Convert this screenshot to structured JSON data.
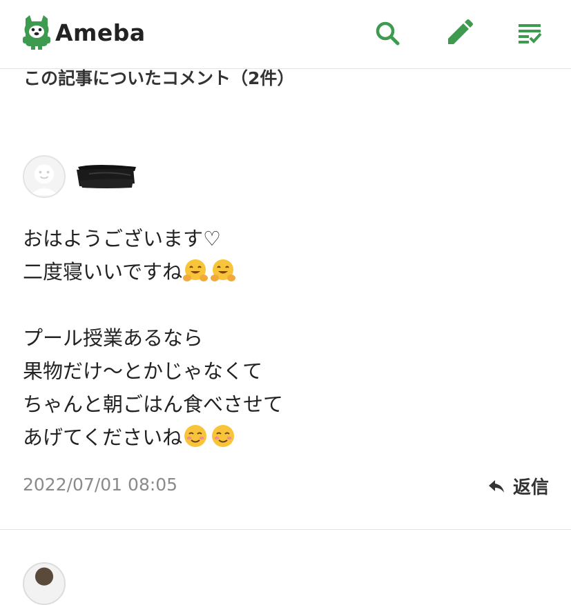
{
  "header": {
    "logo_text": "Ameba",
    "brand_color": "#3d9a4f",
    "icons": [
      "search-icon",
      "pencil-icon",
      "checklist-icon"
    ]
  },
  "comments_section": {
    "title": "この記事についたコメント（2件）"
  },
  "comments": [
    {
      "author": {
        "avatar": "default-avatar-icon",
        "name_redacted": true
      },
      "body_lines": [
        {
          "text": "おはようございます♡",
          "emoji": []
        },
        {
          "text": "二度寝いいですね",
          "emoji": [
            "hugging-face-emoji",
            "hugging-face-emoji"
          ]
        },
        {
          "text": "",
          "emoji": []
        },
        {
          "text": "プール授業あるなら",
          "emoji": []
        },
        {
          "text": "果物だけ〜とかじゃなくて",
          "emoji": []
        },
        {
          "text": "ちゃんと朝ごはん食べさせて",
          "emoji": []
        },
        {
          "text": "あげてくださいね",
          "emoji": [
            "smiling-face-emoji",
            "smiling-face-emoji"
          ]
        }
      ],
      "timestamp": "2022/07/01 08:05",
      "reply_label": "返信"
    }
  ]
}
